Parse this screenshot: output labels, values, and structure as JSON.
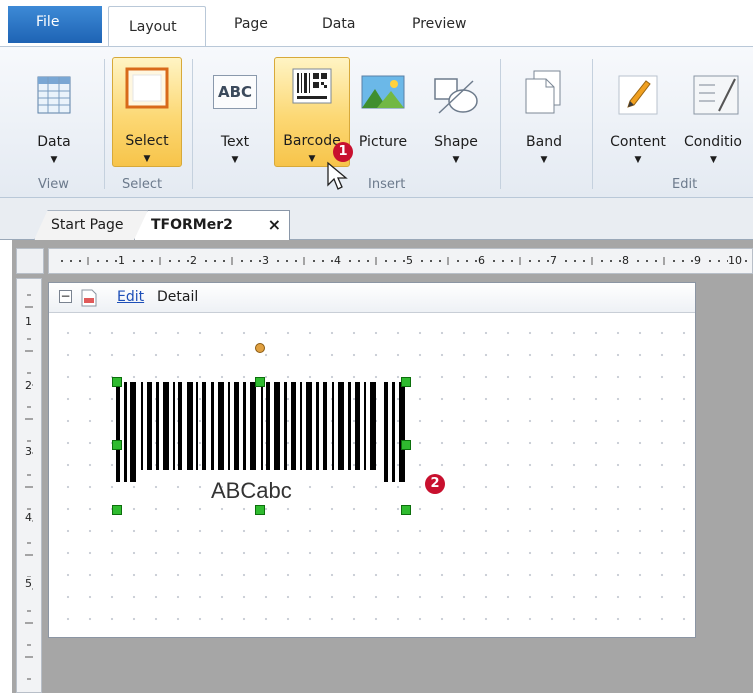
{
  "ribbon_tabs": {
    "file": "File",
    "layout": "Layout",
    "page": "Page",
    "data": "Data",
    "preview": "Preview"
  },
  "ribbon": {
    "buttons": {
      "data": "Data",
      "select": "Select",
      "text": "Text",
      "text_icon": "ABC",
      "barcode": "Barcode",
      "picture": "Picture",
      "shape": "Shape",
      "band": "Band",
      "content": "Content",
      "condition": "Conditio"
    },
    "groups": {
      "view": "View",
      "select": "Select",
      "insert": "Insert",
      "edit": "Edit"
    }
  },
  "document_tabs": {
    "start": "Start Page",
    "current": "TFORMer2",
    "close_glyph": "×"
  },
  "ruler": {
    "horizontal": [
      "1",
      "2",
      "3",
      "4",
      "5",
      "6",
      "7",
      "8",
      "9",
      "10"
    ],
    "vertical": [
      "1",
      "2",
      "3",
      "4",
      "5"
    ]
  },
  "band": {
    "collapse_glyph": "−",
    "edit_link": "Edit",
    "name": "Detail"
  },
  "barcode": {
    "human_readable": "ABCabc"
  },
  "callouts": [
    "1",
    "2"
  ],
  "colors": {
    "file_tab": "#1e63b4",
    "highlight": "#fcd874",
    "handle": "#2fbb2f",
    "callout": "#c8102e",
    "workspace": "#a6a6a6"
  }
}
